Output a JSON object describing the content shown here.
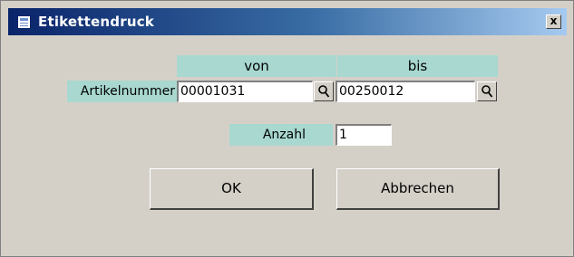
{
  "window": {
    "title": "Etikettendruck",
    "close_glyph": "x"
  },
  "columns": {
    "von": "von",
    "bis": "bis"
  },
  "artikelnummer": {
    "label": "Artikelnummer",
    "von_value": "00001031",
    "bis_value": "00250012"
  },
  "anzahl": {
    "label": "Anzahl",
    "value": "1"
  },
  "buttons": {
    "ok": "OK",
    "cancel": "Abbrechen"
  },
  "icons": {
    "app": "form-icon",
    "lookup": "magnifier-icon",
    "close": "close-icon"
  },
  "colors": {
    "titlebar_start": "#0a246a",
    "titlebar_end": "#a6caf0",
    "label_background": "#a8d8d0",
    "window_background": "#d4d0c8"
  }
}
